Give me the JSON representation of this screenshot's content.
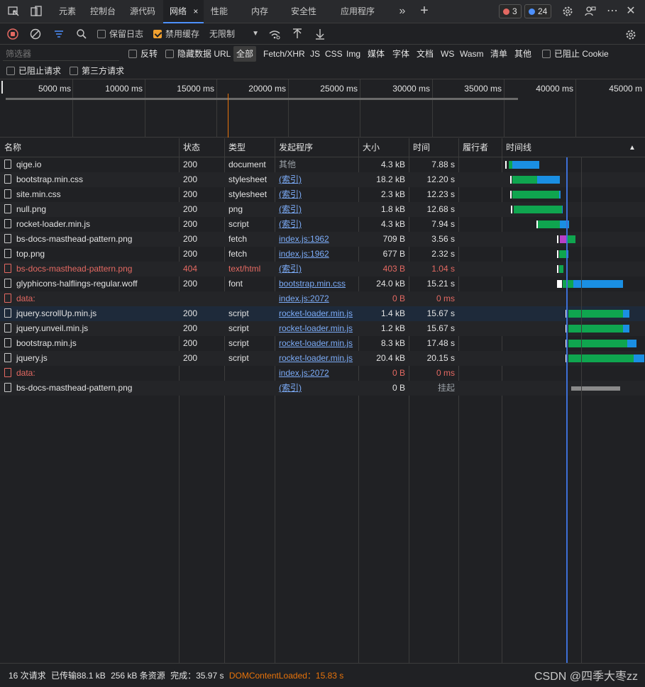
{
  "tabs": [
    "元素",
    "控制台",
    "源代码",
    "网络",
    "性能",
    "内存",
    "安全性",
    "应用程序"
  ],
  "active_tab_close": "×",
  "badges": {
    "errors": "3",
    "issues": "24"
  },
  "toolbar": {
    "preserve_log": "保留日志",
    "disable_cache": "禁用缓存",
    "throttle": "无限制"
  },
  "filter": {
    "placeholder": "筛选器",
    "invert": "反转",
    "hide_data_url": "隐藏数据 URL",
    "types": [
      "全部",
      "Fetch/XHR",
      "JS",
      "CSS",
      "Img",
      "媒体",
      "字体",
      "文档",
      "WS",
      "Wasm",
      "清单",
      "其他"
    ],
    "blocked_cookies": "已阻止 Cookie",
    "blocked_requests": "已阻止请求",
    "third_party": "第三方请求"
  },
  "overview_ticks": [
    "5000 ms",
    "10000 ms",
    "15000 ms",
    "20000 ms",
    "25000 ms",
    "30000 ms",
    "35000 ms",
    "40000 ms",
    "45000 m"
  ],
  "columns": [
    "名称",
    "状态",
    "类型",
    "发起程序",
    "大小",
    "时间",
    "履行者",
    "时间线"
  ],
  "rows": [
    {
      "name": "qige.io",
      "status": "200",
      "type": "document",
      "initiator": "其他",
      "size": "4.3 kB",
      "time": "7.88 s",
      "error": false,
      "link": false
    },
    {
      "name": "bootstrap.min.css",
      "status": "200",
      "type": "stylesheet",
      "initiator": "(索引)",
      "size": "18.2 kB",
      "time": "12.20 s",
      "error": false,
      "link": true
    },
    {
      "name": "site.min.css",
      "status": "200",
      "type": "stylesheet",
      "initiator": "(索引)",
      "size": "2.3 kB",
      "time": "12.23 s",
      "error": false,
      "link": true
    },
    {
      "name": "null.png",
      "status": "200",
      "type": "png",
      "initiator": "(索引)",
      "size": "1.8 kB",
      "time": "12.68 s",
      "error": false,
      "link": true
    },
    {
      "name": "rocket-loader.min.js",
      "status": "200",
      "type": "script",
      "initiator": "(索引)",
      "size": "4.3 kB",
      "time": "7.94 s",
      "error": false,
      "link": true
    },
    {
      "name": "bs-docs-masthead-pattern.png",
      "status": "200",
      "type": "fetch",
      "initiator": "index.js:1962",
      "size": "709 B",
      "time": "3.56 s",
      "error": false,
      "link": true
    },
    {
      "name": "top.png",
      "status": "200",
      "type": "fetch",
      "initiator": "index.js:1962",
      "size": "677 B",
      "time": "2.32 s",
      "error": false,
      "link": true
    },
    {
      "name": "bs-docs-masthead-pattern.png",
      "status": "404",
      "type": "text/html",
      "initiator": "(索引)",
      "size": "403 B",
      "time": "1.04 s",
      "error": true,
      "link": true
    },
    {
      "name": "glyphicons-halflings-regular.woff",
      "status": "200",
      "type": "font",
      "initiator": "bootstrap.min.css",
      "size": "24.0 kB",
      "time": "15.21 s",
      "error": false,
      "link": true
    },
    {
      "name": "data:",
      "status": "",
      "type": "",
      "initiator": "index.js:2072",
      "size": "0 B",
      "time": "0 ms",
      "error": true,
      "link": true
    },
    {
      "name": "jquery.scrollUp.min.js",
      "status": "200",
      "type": "script",
      "initiator": "rocket-loader.min.js",
      "size": "1.4 kB",
      "time": "15.67 s",
      "error": false,
      "link": true
    },
    {
      "name": "jquery.unveil.min.js",
      "status": "200",
      "type": "script",
      "initiator": "rocket-loader.min.js",
      "size": "1.2 kB",
      "time": "15.67 s",
      "error": false,
      "link": true
    },
    {
      "name": "bootstrap.min.js",
      "status": "200",
      "type": "script",
      "initiator": "rocket-loader.min.js",
      "size": "8.3 kB",
      "time": "17.48 s",
      "error": false,
      "link": true
    },
    {
      "name": "jquery.js",
      "status": "200",
      "type": "script",
      "initiator": "rocket-loader.min.js",
      "size": "20.4 kB",
      "time": "20.15 s",
      "error": false,
      "link": true
    },
    {
      "name": "data:",
      "status": "",
      "type": "",
      "initiator": "index.js:2072",
      "size": "0 B",
      "time": "0 ms",
      "error": true,
      "link": true
    },
    {
      "name": "bs-docs-masthead-pattern.png",
      "status": "",
      "type": "",
      "initiator": "(索引)",
      "size": "0 B",
      "time": "挂起",
      "error": false,
      "link": true
    }
  ],
  "footer": {
    "requests": "16 次请求",
    "transferred": "已传输88.1 kB",
    "resources": "256 kB 条资源",
    "finish": "完成：35.97 s",
    "dcl": "DOMContentLoaded：15.83 s"
  },
  "watermark": "CSDN @四季大枣zz"
}
